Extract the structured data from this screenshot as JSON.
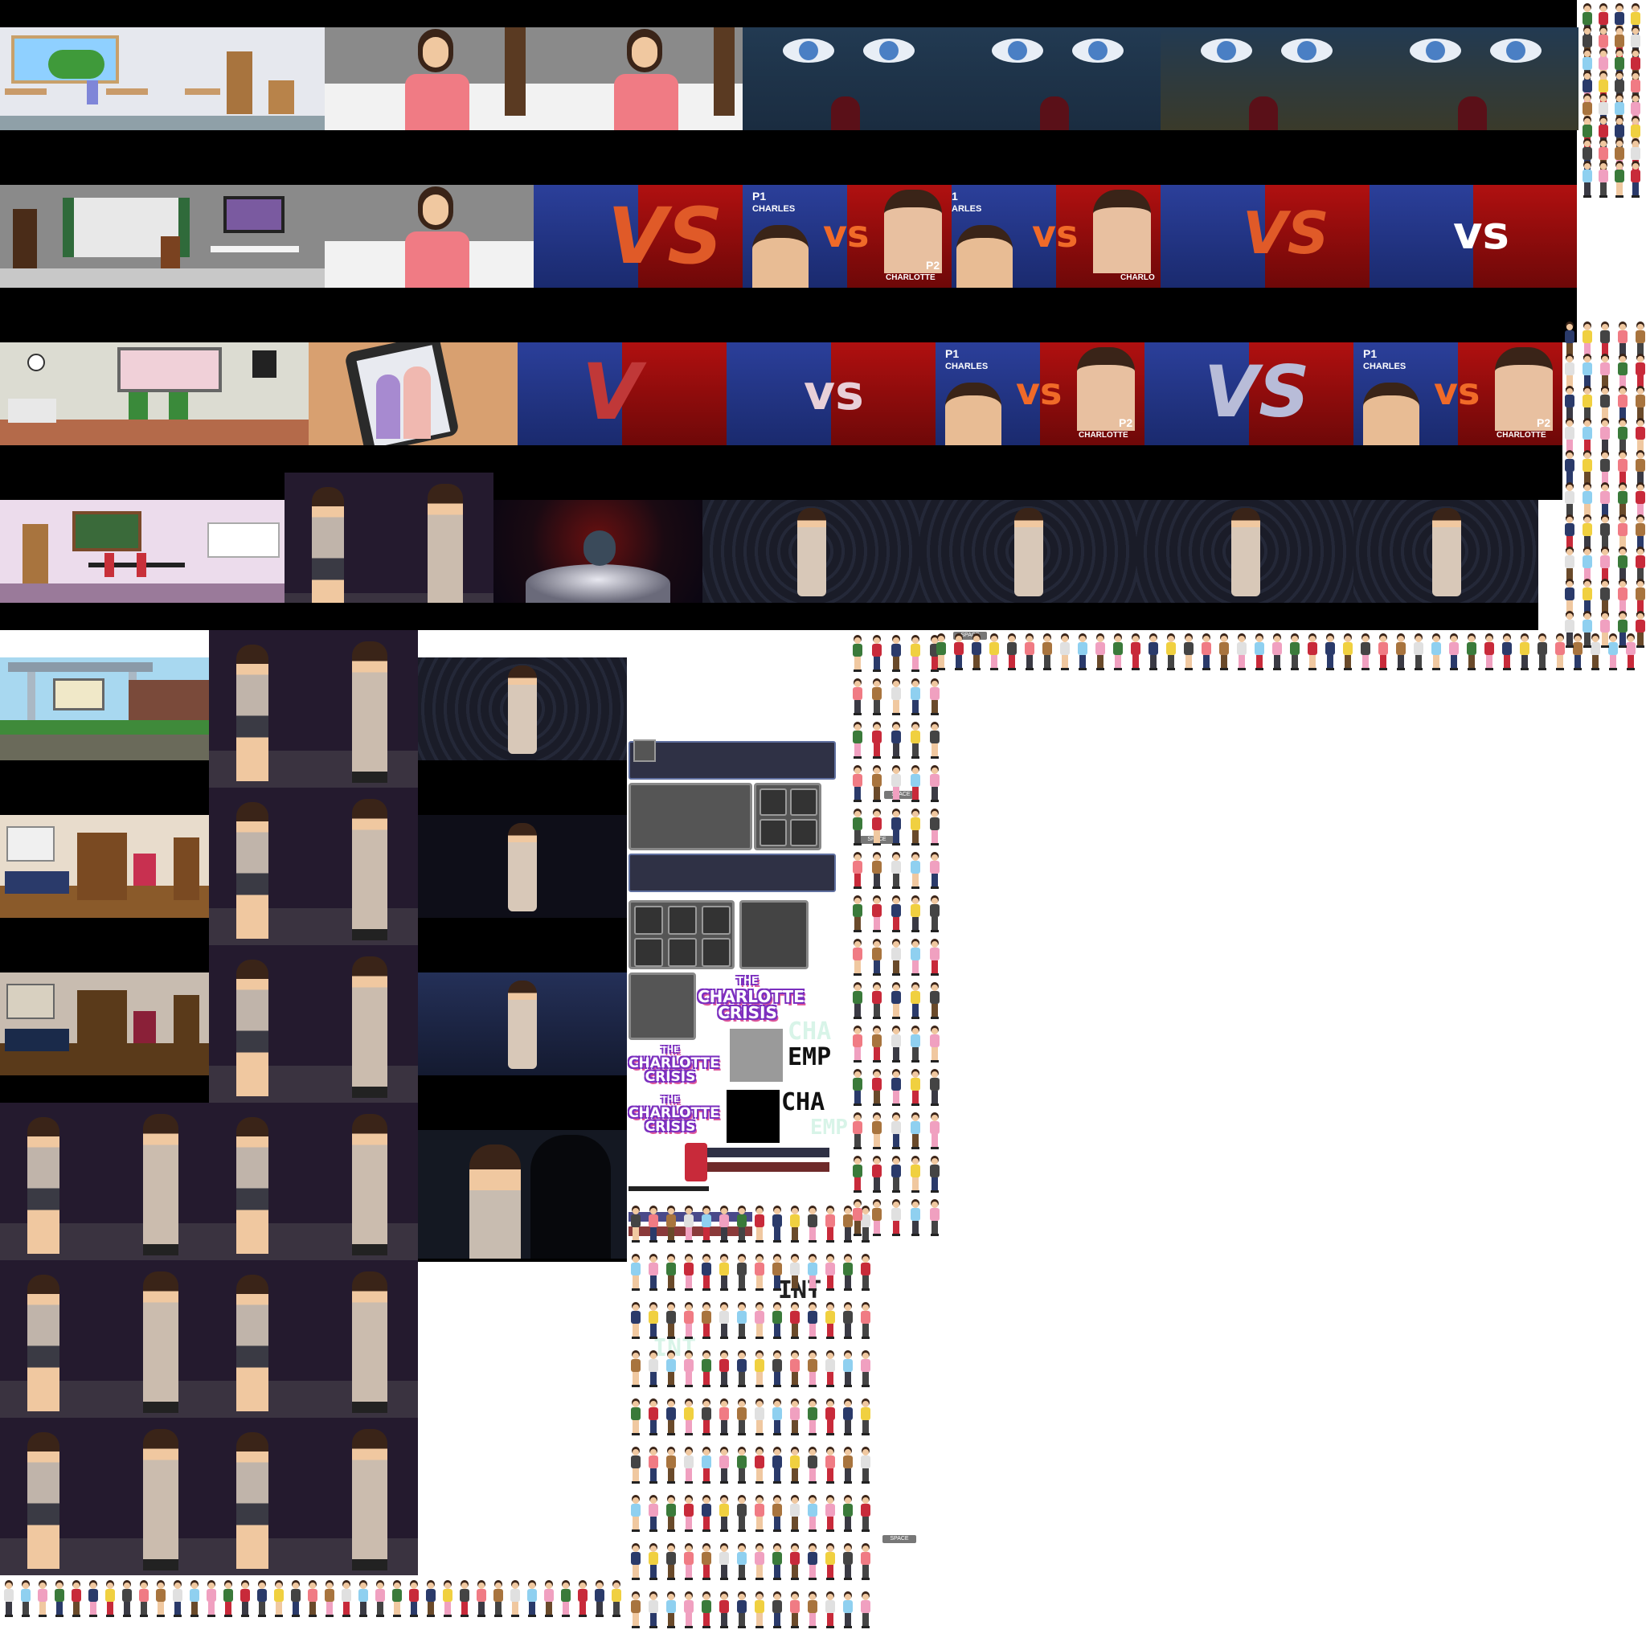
{
  "vs_screens": {
    "big_vs": "VS",
    "small_vs": "vs",
    "partial_v": "V",
    "p1_tag": "P1",
    "p1_name": "CHARLES",
    "p2_tag": "P2",
    "p2_name": "CHARLOTTE",
    "p2_name_cut": "CHARLO",
    "p1_name_cut": "ARLES",
    "p1_tag_cut": "1"
  },
  "logo": {
    "line1": "THE",
    "line2": "CHARLOTTE",
    "line3": "CRISIS"
  },
  "stat_labels": {
    "cha": "CHA",
    "emp": "EMP",
    "int": "INT"
  },
  "key_prompt": {
    "space": "SPACE"
  },
  "colors": {
    "vs_blue": "#2b3f9a",
    "vs_red": "#b01010",
    "ui_panel": "#2f3145",
    "logo_purple": "#7b2fbf",
    "logo_pink": "#e05a9a"
  }
}
